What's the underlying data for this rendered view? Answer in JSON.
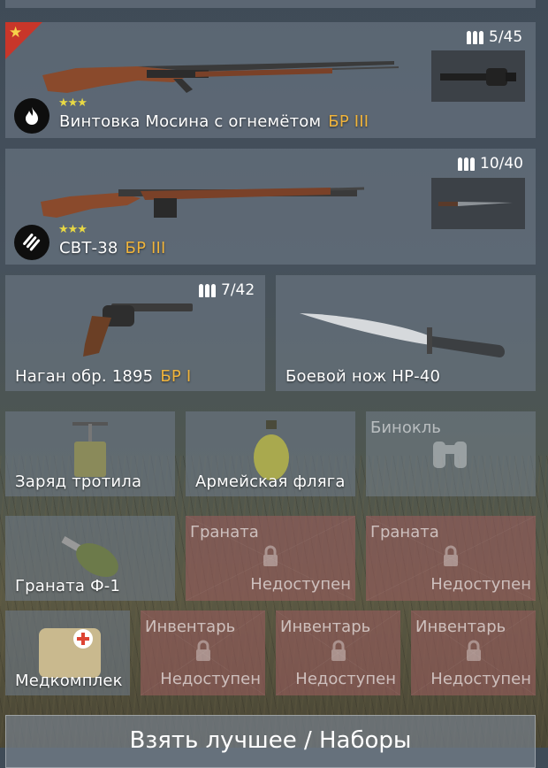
{
  "weapons": [
    {
      "name": "Винтовка Мосина с огнемётом",
      "br": "БР III",
      "ammo": "5/45",
      "stars": "★★★",
      "icon": "flame-icon",
      "attachment": "flamethrower-attachment",
      "rank_icon": "star-icon"
    },
    {
      "name": "СВТ-38",
      "br": "БР III",
      "ammo": "10/40",
      "stars": "★★★",
      "icon": "ammo-clip-icon",
      "attachment": "bayonet-attachment"
    }
  ],
  "sidearm": {
    "name": "Наган обр. 1895",
    "br": "БР I",
    "ammo": "7/42"
  },
  "melee": {
    "name": "Боевой нож НР-40"
  },
  "equipment": [
    {
      "name": "Заряд тротила"
    },
    {
      "name": "Армейская фляга"
    },
    {
      "name": "Бинокль"
    }
  ],
  "grenades": [
    {
      "name": "Граната Ф-1"
    },
    {
      "name": "Граната",
      "status": "Недоступен"
    },
    {
      "name": "Граната",
      "status": "Недоступен"
    }
  ],
  "inventory": [
    {
      "name": "Медкомплек"
    },
    {
      "name": "Инвентарь",
      "status": "Недоступен"
    },
    {
      "name": "Инвентарь",
      "status": "Недоступен"
    },
    {
      "name": "Инвентарь",
      "status": "Недоступен"
    }
  ],
  "bottom_button": "Взять лучшее / Наборы",
  "colors": {
    "br": "#f0b43c",
    "panel": "#6c7884",
    "locked": "#965c5c",
    "stars": "#e8d844"
  }
}
